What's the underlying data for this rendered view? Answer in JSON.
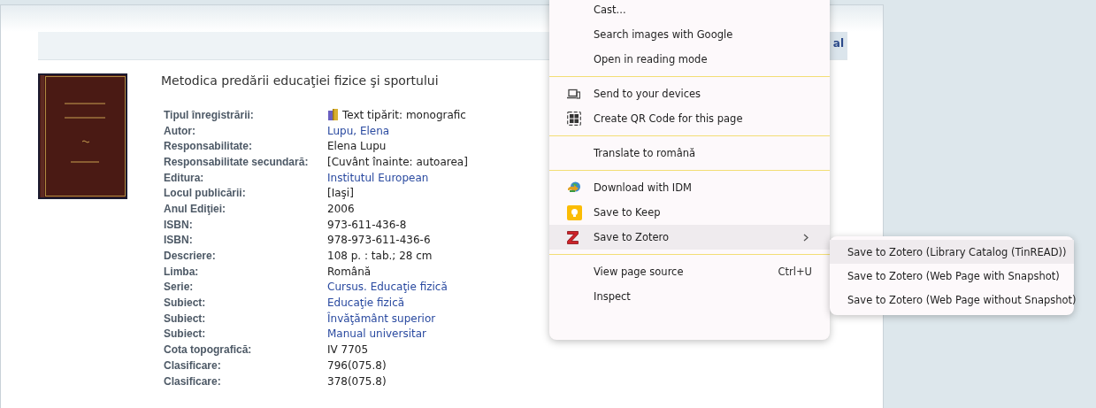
{
  "toolbar": {
    "tab_text": "al"
  },
  "record": {
    "title": "Metodica predării educaţiei fizice şi sportului",
    "fields": [
      {
        "label": "Tipul înregistrării:",
        "value": "Text tipărit: monografic",
        "kind": "type"
      },
      {
        "label": "Autor:",
        "value": "Lupu, Elena",
        "kind": "link"
      },
      {
        "label": "Responsabilitate:",
        "value": "Elena Lupu",
        "kind": "text"
      },
      {
        "label": "Responsabilitate secundară:",
        "value": "[Cuvânt înainte: autoarea]",
        "kind": "text"
      },
      {
        "label": "Editura:",
        "value": "Institutul European",
        "kind": "link"
      },
      {
        "label": "Locul publicării:",
        "value": "[Iaşi]",
        "kind": "text"
      },
      {
        "label": "Anul Ediţiei:",
        "value": "2006",
        "kind": "text"
      },
      {
        "label": "ISBN:",
        "value": "973-611-436-8",
        "kind": "text"
      },
      {
        "label": "ISBN:",
        "value": "978-973-611-436-6",
        "kind": "text"
      },
      {
        "label": "Descriere:",
        "value": "108 p. : tab.; 28 cm",
        "kind": "text"
      },
      {
        "label": "Limba:",
        "value": "Română",
        "kind": "text"
      },
      {
        "label": "Serie:",
        "value": "Cursus. Educaţie fizică",
        "kind": "link"
      },
      {
        "label": "Subiect:",
        "value": "Educaţie fizică",
        "kind": "link"
      },
      {
        "label": "Subiect:",
        "value": "Învăţământ superior",
        "kind": "link"
      },
      {
        "label": "Subiect:",
        "value": "Manual universitar",
        "kind": "link"
      },
      {
        "label": "Cota topografică:",
        "value": "IV 7705",
        "kind": "text"
      },
      {
        "label": "Clasificare:",
        "value": "796(075.8)",
        "kind": "text"
      },
      {
        "label": "Clasificare:",
        "value": "378(075.8)",
        "kind": "text"
      }
    ]
  },
  "context_menu": {
    "items": [
      {
        "kind": "plain",
        "label": "Cast...",
        "selected": false
      },
      {
        "kind": "plain",
        "label": "Search images with Google",
        "selected": false
      },
      {
        "kind": "plain",
        "label": "Open in reading mode",
        "selected": false
      },
      {
        "kind": "separator"
      },
      {
        "kind": "devices",
        "label": "Send to your devices",
        "selected": false
      },
      {
        "kind": "qr",
        "label": "Create QR Code for this page",
        "selected": false
      },
      {
        "kind": "separator"
      },
      {
        "kind": "plain",
        "label": "Translate to română",
        "selected": false
      },
      {
        "kind": "separator"
      },
      {
        "kind": "download",
        "label": "Download with IDM",
        "selected": false
      },
      {
        "kind": "keep",
        "label": "Save to Keep",
        "selected": false
      },
      {
        "kind": "zotero",
        "label": "Save to Zotero",
        "selected": true,
        "submenu": true
      },
      {
        "kind": "separator"
      },
      {
        "kind": "plain",
        "label": "View page source",
        "shortcut": "Ctrl+U",
        "selected": false
      },
      {
        "kind": "plain",
        "label": "Inspect",
        "selected": false
      }
    ]
  },
  "submenu": {
    "items": [
      {
        "label": "Save to Zotero (Library Catalog (TinREAD))",
        "selected": true
      },
      {
        "label": "Save to Zotero (Web Page with Snapshot)",
        "selected": false
      },
      {
        "label": "Save to Zotero (Web Page without Snapshot)",
        "selected": false
      }
    ]
  }
}
